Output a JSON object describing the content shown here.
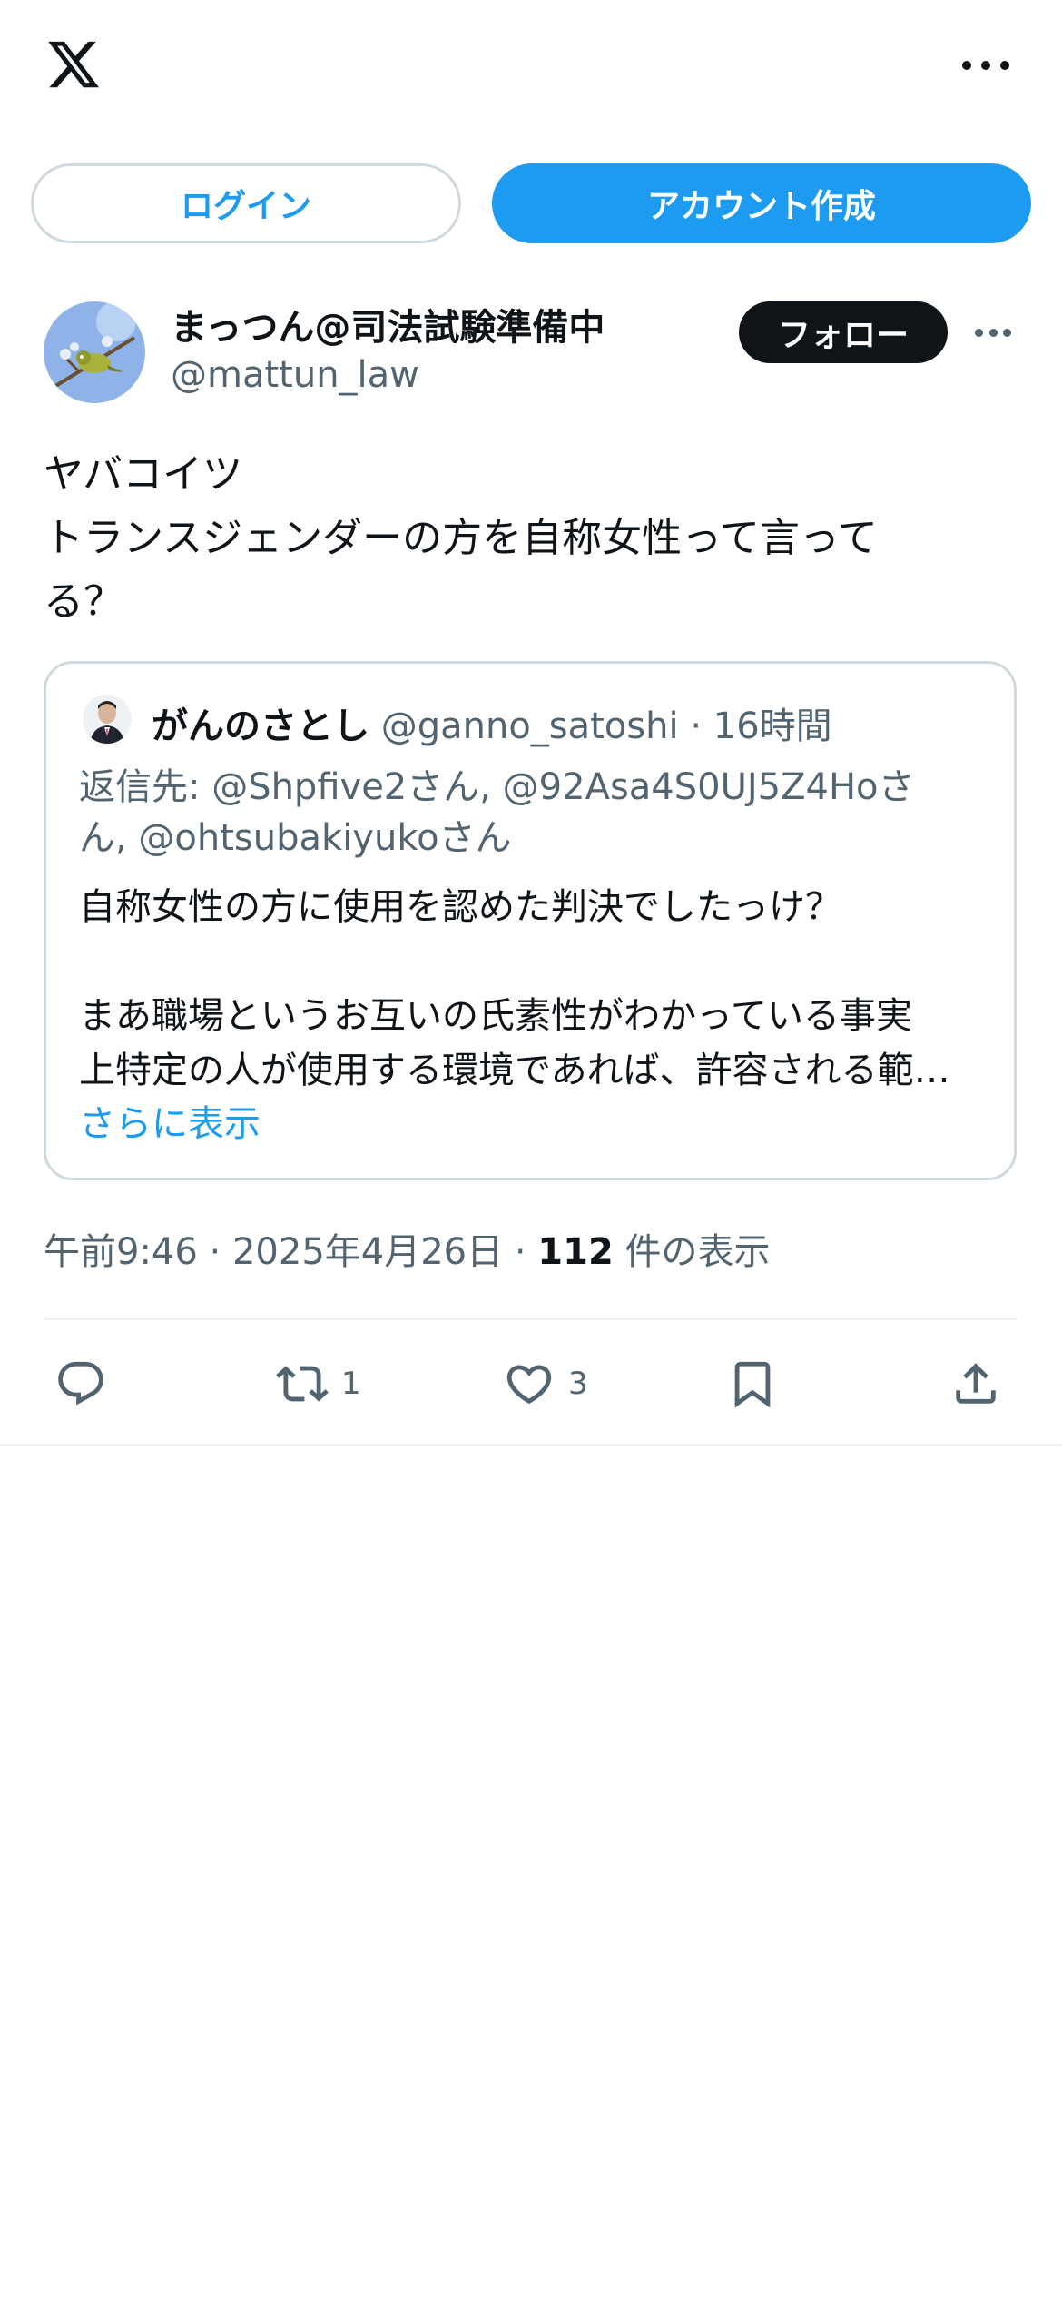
{
  "topbar": {
    "logo": "x-logo",
    "more": "more-icon"
  },
  "auth": {
    "login_label": "ログイン",
    "signup_label": "アカウント作成"
  },
  "post": {
    "author_name": "まっつん@司法試験準備中",
    "author_handle": "@mattun_law",
    "follow_label": "フォロー",
    "text_lines": [
      "ヤバコイツ",
      "トランスジェンダーの方を自称女性って言って",
      "る？"
    ],
    "meta": {
      "time": "午前9:46",
      "sep1": "·",
      "date": "2025年4月26日",
      "sep2": "·",
      "views": "112",
      "views_label": "件の表示"
    },
    "actions": {
      "reply_count": "",
      "repost_count": "1",
      "like_count": "3"
    }
  },
  "quote": {
    "name": "がんのさとし",
    "handle": "@ganno_satoshi",
    "sep": "·",
    "time": "16時間",
    "reply_lines": [
      "返信先: @Shpfive2さん, @92Asa4S0UJ5Z4Hoさ",
      "ん, @ohtsubakiyukoさん"
    ],
    "body_lines": [
      "自称女性の方に使用を認めた判決でしたっけ？",
      "",
      "まあ職場というお互いの氏素性がわかっている事実",
      "上特定の人が使用する環境であれば、許容される範…"
    ],
    "show_more": "さらに表示"
  },
  "colors": {
    "accent": "#1d9bf0",
    "text": "#0f1419",
    "secondary": "#536471",
    "border": "#cfd9de"
  }
}
